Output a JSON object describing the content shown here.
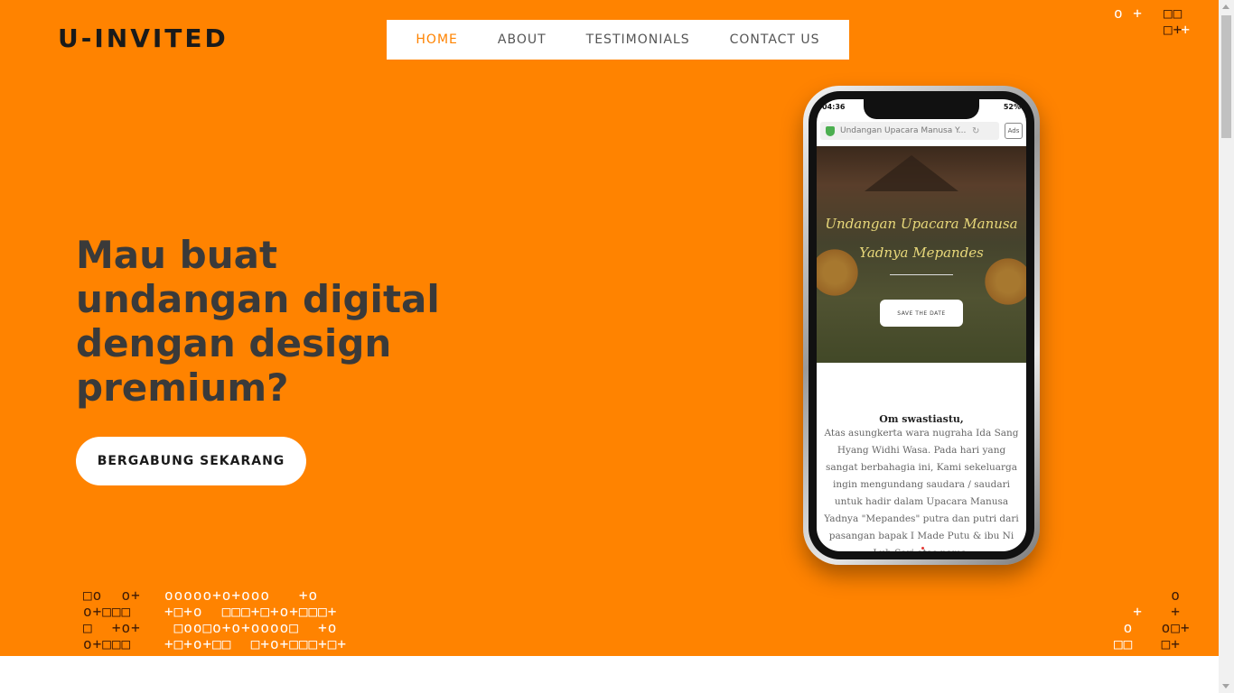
{
  "brand": {
    "logo": "U-INVITED"
  },
  "nav": {
    "items": [
      {
        "label": "HOME",
        "active": true
      },
      {
        "label": "ABOUT",
        "active": false
      },
      {
        "label": "TESTIMONIALS",
        "active": false
      },
      {
        "label": "CONTACT US",
        "active": false
      }
    ]
  },
  "hero": {
    "headline": "Mau buat undangan digital dengan design premium?",
    "cta_label": "BERGABUNG SEKARANG"
  },
  "phone": {
    "status_time": "04:36",
    "status_battery": "52%",
    "url_text": "Undangan Upacara Manusa Y...",
    "ads_label": "Ads",
    "banner_title": "Undangan Upacara Manusa Yadnya Mepandes",
    "save_button": "SAVE THE DATE",
    "greeting": "Om swastiastu,",
    "body_text": "Atas asungkerta wara nugraha Ida Sang Hyang Widhi Wasa. Pada hari yang sangat berbahagia ini, Kami sekeluarga ingin mengundang saudara / saudari untuk hadir dalam Upacara Manusa Yadnya \"Mepandes\" putra dan putri dari pasangan bapak I Made Putu & ibu Ni Luh Sari atas nama:"
  },
  "colors": {
    "accent": "#ff8300",
    "text_dark": "#3a3a3a",
    "nav_text": "#555555",
    "pattern_dark": "#3d1a06",
    "white": "#ffffff"
  }
}
